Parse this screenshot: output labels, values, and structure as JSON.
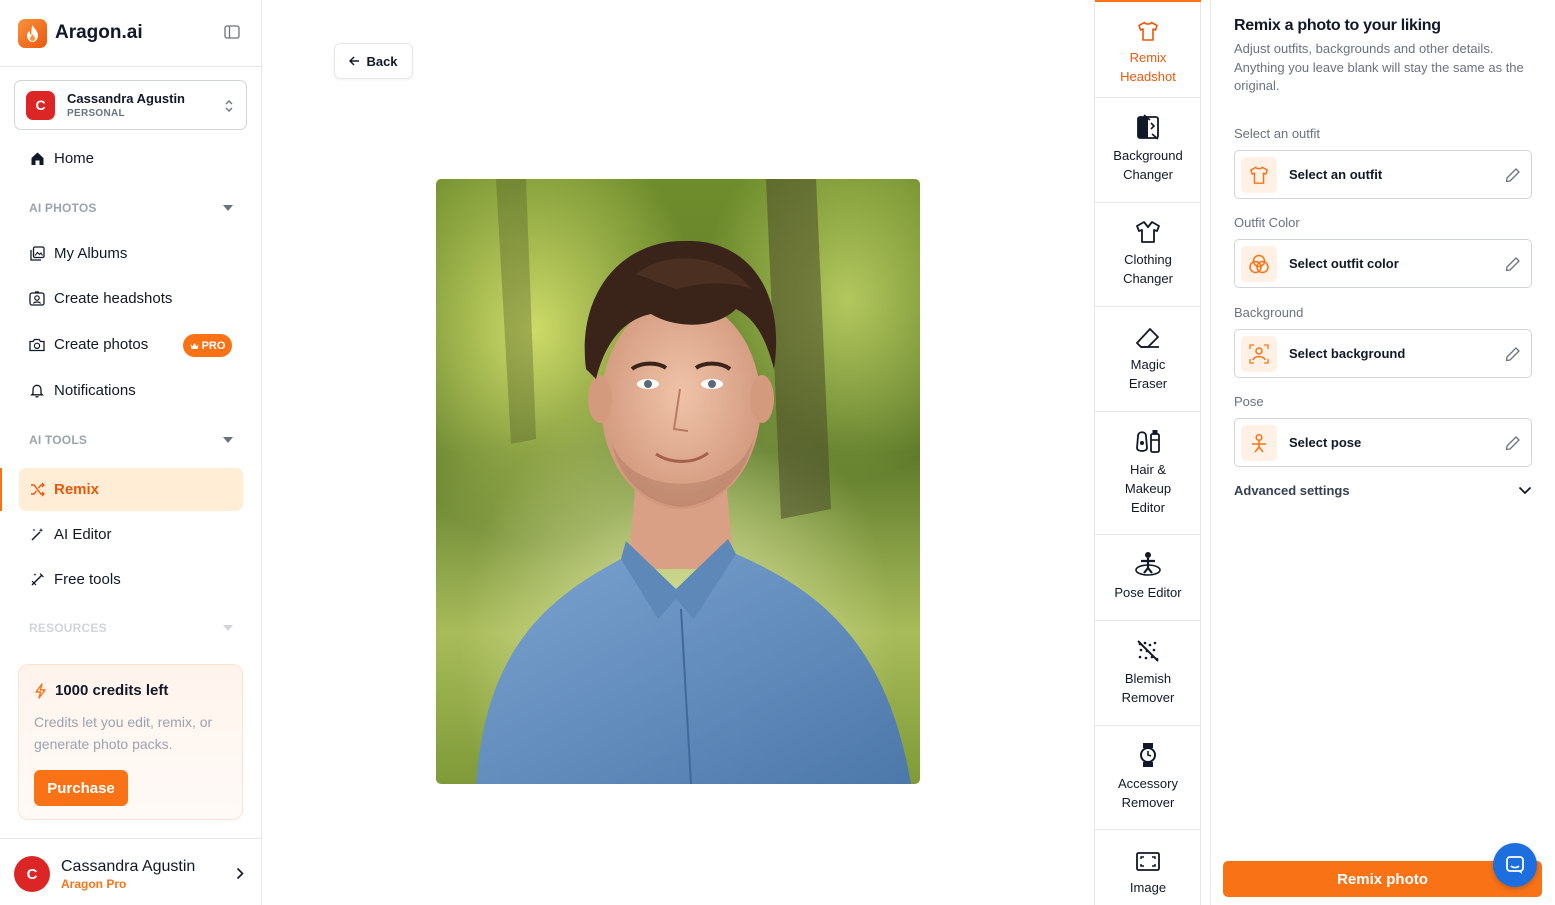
{
  "brand": {
    "name": "Aragon.ai",
    "logo_icon": "flame-icon",
    "accent": "#f97316"
  },
  "account": {
    "initial": "C",
    "name": "Cassandra Agustin",
    "type": "PERSONAL"
  },
  "nav": {
    "home": "Home",
    "ai_photos_header": "AI PHOTOS",
    "my_albums": "My Albums",
    "create_headshots": "Create headshots",
    "create_photos": "Create photos",
    "pro_badge": "PRO",
    "notifications": "Notifications",
    "ai_tools_header": "AI TOOLS",
    "remix": "Remix",
    "ai_editor": "AI Editor",
    "free_tools": "Free tools",
    "resources_header": "RESOURCES"
  },
  "credits": {
    "title": "1000 credits left",
    "description": "Credits let you edit, remix, or generate photo packs.",
    "purchase_label": "Purchase"
  },
  "user_footer": {
    "initial": "C",
    "name": "Cassandra Agustin",
    "plan": "Aragon Pro"
  },
  "main": {
    "back_label": "Back"
  },
  "tools": [
    {
      "line1": "Remix",
      "line2": "Headshot",
      "icon": "shirt-icon"
    },
    {
      "line1": "Background",
      "line2": "Changer",
      "icon": "background-swap-icon"
    },
    {
      "line1": "Clothing",
      "line2": "Changer",
      "icon": "clothing-icon"
    },
    {
      "line1": "Magic",
      "line2": "Eraser",
      "icon": "eraser-icon"
    },
    {
      "line1": "Hair &",
      "line2": "Makeup",
      "line3": "Editor",
      "icon": "hair-makeup-icon"
    },
    {
      "line1": "Pose Editor",
      "icon": "pose-icon"
    },
    {
      "line1": "Blemish",
      "line2": "Remover",
      "icon": "blemish-icon"
    },
    {
      "line1": "Accessory",
      "line2": "Remover",
      "icon": "watch-icon"
    },
    {
      "line1": "Image",
      "icon": "image-expand-icon"
    }
  ],
  "panel": {
    "title": "Remix a photo to your liking",
    "description": "Adjust outfits, backgrounds and other details. Anything you leave blank will stay the same as the original.",
    "outfit_label": "Select an outfit",
    "outfit_value": "Select an outfit",
    "color_label": "Outfit Color",
    "color_value": "Select outfit color",
    "background_label": "Background",
    "background_value": "Select background",
    "pose_label": "Pose",
    "pose_value": "Select pose",
    "advanced_label": "Advanced settings",
    "remix_button": "Remix photo"
  }
}
